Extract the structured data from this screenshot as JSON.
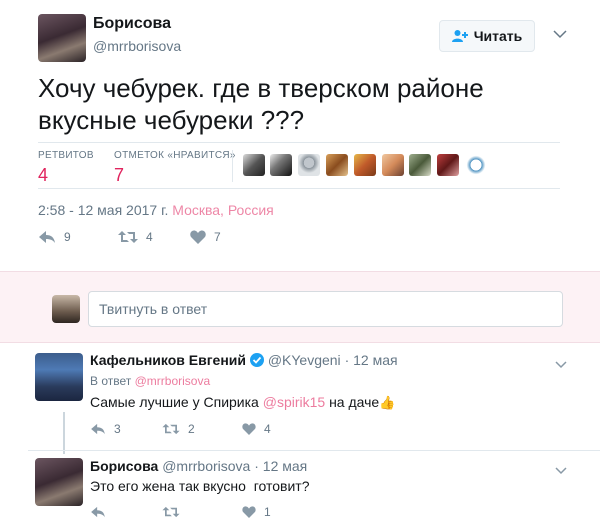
{
  "main_tweet": {
    "name": "Борисова",
    "handle": "@mrrborisova",
    "follow_label": "Читать",
    "text": "Хочу чебурек. где в тверском районе вкусные чебуреки ???",
    "retweets_label": "РЕТВИТОВ",
    "retweets_count": "4",
    "likes_label": "ОТМЕТОК «НРАВИТСЯ»",
    "likes_count": "7",
    "time": "2:58 - 12 мая 2017 г.",
    "location": "Москва, Россия",
    "actions": {
      "replies": "9",
      "retweets": "4",
      "likes": "7"
    }
  },
  "reply_box": {
    "placeholder": "Твитнуть в ответ"
  },
  "replies": [
    {
      "name": "Кафельников Евгений",
      "handle": "@KYevgeni",
      "date": "12 мая",
      "in_reply_prefix": "В ответ",
      "in_reply_handle": "@mrrborisova",
      "text_before": "Самые лучшие у Спирика",
      "mention": "@spirik15",
      "text_after": "на даче",
      "emoji": "👍",
      "actions": {
        "replies": "3",
        "retweets": "2",
        "likes": "4"
      }
    },
    {
      "name": "Борисова",
      "handle": "@mrrborisova",
      "date": "12 мая",
      "text": "Это его жена так вкусно  готовит?",
      "actions": {
        "replies": "",
        "retweets": "",
        "likes": "1"
      }
    }
  ],
  "colors": {
    "accent": "#e0245e",
    "text": "#14171a",
    "muted": "#657786",
    "verified": "#1da1f2"
  },
  "icons": [
    "follow-icon",
    "chevron-down-icon",
    "reply-icon",
    "retweet-icon",
    "like-icon",
    "verified-icon"
  ]
}
